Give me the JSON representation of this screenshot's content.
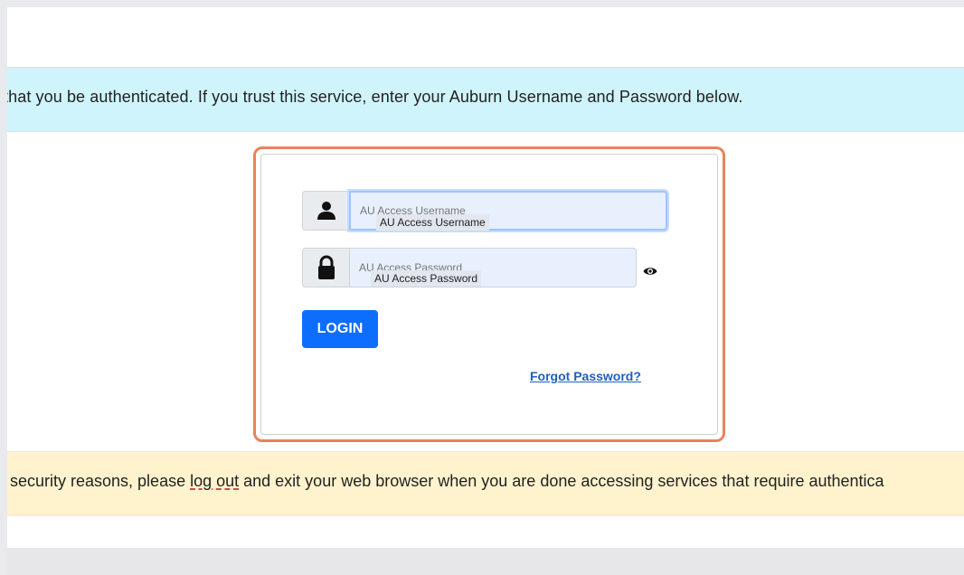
{
  "info_banner": {
    "text": "that you be authenticated. If you trust this service, enter your Auburn Username and Password below."
  },
  "login_form": {
    "username": {
      "icon": "user-icon",
      "value": "",
      "placeholder": "AU Access Username"
    },
    "password": {
      "icon": "lock-icon",
      "value": "",
      "placeholder": "AU Access Password",
      "toggle_icon": "eye-icon"
    },
    "login_button": "LOGIN",
    "forgot_link": "Forgot Password?"
  },
  "warning_banner": {
    "text_before": "r security reasons, please ",
    "link": "log out",
    "text_after": " and exit your web browser when you are done accessing services that require authentica"
  },
  "footer": {
    "title": ""
  },
  "colors": {
    "info_bg": "#cff4fc",
    "warning_bg": "#fff3cd",
    "primary": "#0d6efd",
    "card_highlight": "#e8835a",
    "link": "#1f5fbf"
  }
}
